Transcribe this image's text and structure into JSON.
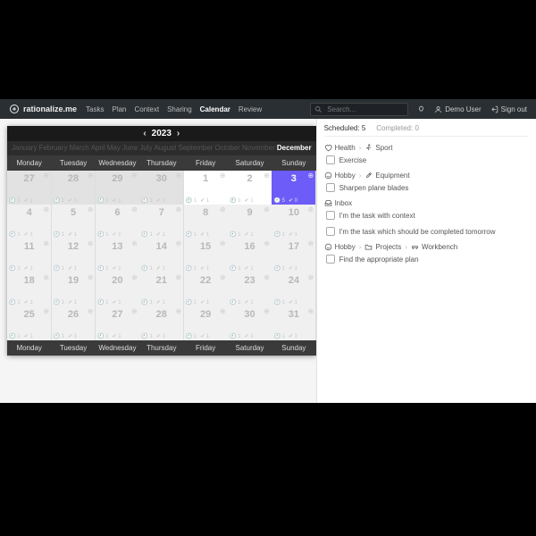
{
  "brand": "rationalize.me",
  "nav": {
    "items": [
      "Tasks",
      "Plan",
      "Context",
      "Sharing",
      "Calendar",
      "Review"
    ],
    "activeIndex": 4
  },
  "search": {
    "placeholder": "Search..."
  },
  "topright": {
    "demolink": "Demo User",
    "signout": "Sign out",
    "roadmap": "?"
  },
  "calendar": {
    "year": "2023",
    "months": [
      "January",
      "February",
      "March",
      "April",
      "May",
      "June",
      "July",
      "August",
      "September",
      "October",
      "November",
      "December"
    ],
    "activeMonthIndex": 11,
    "daysShort": [
      "Monday",
      "Tuesday",
      "Wednesday",
      "Thursday",
      "Friday",
      "Saturday",
      "Sunday"
    ],
    "cells": [
      {
        "n": 27,
        "other": true,
        "a": 1,
        "b": 1
      },
      {
        "n": 28,
        "other": true,
        "a": 1,
        "b": 1
      },
      {
        "n": 29,
        "other": true,
        "a": 1,
        "b": 1
      },
      {
        "n": 30,
        "other": true,
        "a": 1,
        "b": 1
      },
      {
        "n": 1,
        "spot": true,
        "a": 1,
        "b": 1
      },
      {
        "n": 2,
        "spot": true,
        "a": 1,
        "b": 1
      },
      {
        "n": 3,
        "sel": true,
        "a": 5,
        "b": 0
      },
      {
        "n": 4,
        "a": 1,
        "b": 1
      },
      {
        "n": 5,
        "a": 1,
        "b": 1
      },
      {
        "n": 6,
        "a": 1,
        "b": 1
      },
      {
        "n": 7,
        "a": 1,
        "b": 1
      },
      {
        "n": 8,
        "a": 1,
        "b": 1
      },
      {
        "n": 9,
        "a": 1,
        "b": 1
      },
      {
        "n": 10,
        "a": 1,
        "b": 1
      },
      {
        "n": 11,
        "a": 1,
        "b": 1
      },
      {
        "n": 12,
        "a": 1,
        "b": 1
      },
      {
        "n": 13,
        "a": 1,
        "b": 1
      },
      {
        "n": 14,
        "a": 1,
        "b": 1
      },
      {
        "n": 15,
        "a": 1,
        "b": 1
      },
      {
        "n": 16,
        "a": 1,
        "b": 1
      },
      {
        "n": 17,
        "a": 1,
        "b": 1
      },
      {
        "n": 18,
        "a": 1,
        "b": 1
      },
      {
        "n": 19,
        "a": 1,
        "b": 1
      },
      {
        "n": 20,
        "a": 1,
        "b": 1
      },
      {
        "n": 21,
        "a": 1,
        "b": 1
      },
      {
        "n": 22,
        "a": 1,
        "b": 1
      },
      {
        "n": 23,
        "a": 1,
        "b": 1
      },
      {
        "n": 24,
        "a": 1,
        "b": 1
      },
      {
        "n": 25,
        "a": 1,
        "b": 1
      },
      {
        "n": 26,
        "a": 1,
        "b": 1
      },
      {
        "n": 27,
        "a": 1,
        "b": 1
      },
      {
        "n": 28,
        "a": 1,
        "b": 1
      },
      {
        "n": 29,
        "a": 1,
        "b": 1
      },
      {
        "n": 30,
        "a": 1,
        "b": 1
      },
      {
        "n": 31,
        "a": 1,
        "b": 1
      }
    ]
  },
  "sidebar": {
    "tabs": {
      "scheduled": {
        "label": "Scheduled:",
        "count": 5
      },
      "completed": {
        "label": "Completed:",
        "count": 0
      }
    },
    "groups": [
      {
        "crumb": [
          {
            "icon": "heart",
            "label": "Health"
          },
          {
            "icon": "run",
            "label": "Sport"
          }
        ],
        "task": "Exercise"
      },
      {
        "crumb": [
          {
            "icon": "smile",
            "label": "Hobby"
          },
          {
            "icon": "tool",
            "label": "Equipment"
          }
        ],
        "task": "Sharpen plane blades"
      },
      {
        "crumb": [
          {
            "icon": "inbox",
            "label": "Inbox"
          }
        ],
        "task": "I'm the task with context"
      },
      {
        "crumb": [],
        "task": "I'm the task which should be completed tomorrow",
        "plain": true
      },
      {
        "crumb": [
          {
            "icon": "smile",
            "label": "Hobby"
          },
          {
            "icon": "folder",
            "label": "Projects"
          },
          {
            "icon": "bench",
            "label": "Workbench"
          }
        ],
        "task": "Find the appropriate plan"
      }
    ]
  }
}
